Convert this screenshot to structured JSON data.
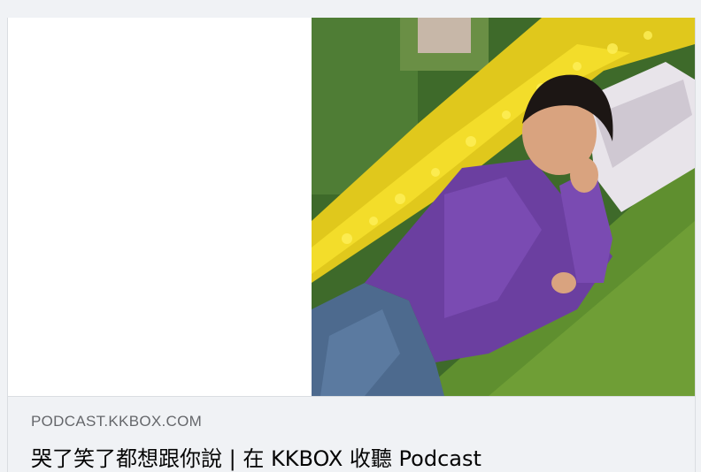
{
  "link_preview": {
    "domain": "PODCAST.KKBOX.COM",
    "title": "哭了笑了都想跟你說 | 在 KKBOX 收聽 Podcast",
    "image": {
      "subject": "woman-lying-on-grass-photo"
    }
  },
  "colors": {
    "page_background": "#f0f2f5",
    "card_background": "#ffffff",
    "domain_text": "#65676b",
    "title_text": "#050505",
    "border": "#dadde1"
  }
}
